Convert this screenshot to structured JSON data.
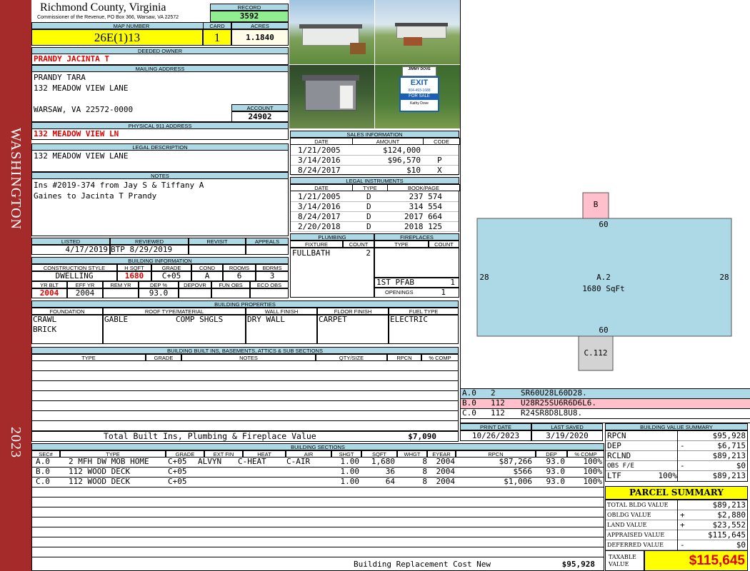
{
  "sidebar": {
    "district": "WASHINGTON",
    "year": "2023"
  },
  "header": {
    "county": "Richmond County, Virginia",
    "commissioner": "Commissioner of the Revenue, PO Box 366, Warsaw, VA 22572",
    "record_label": "RECORD",
    "record": "3592",
    "map_label": "MAP NUMBER",
    "map_number": "26E(1)13",
    "card_label": "CARD",
    "card": "1",
    "acres_label": "ACRES",
    "acres": "1.1840"
  },
  "owner": {
    "label": "DEEDED OWNER",
    "name": "PRANDY JACINTA T"
  },
  "mailing": {
    "label": "MAILING ADDRESS",
    "line1": "PRANDY TARA",
    "line2": "132 MEADOW VIEW LANE",
    "line3": "WARSAW, VA 22572-0000",
    "account_label": "ACCOUNT",
    "account": "24902"
  },
  "physical": {
    "label": "PHYSICAL 911 ADDRESS",
    "address": "132 MEADOW VIEW LN"
  },
  "legal": {
    "label": "LEGAL DESCRIPTION",
    "text": "132 MEADOW VIEW LANE"
  },
  "notes": {
    "label": "NOTES",
    "line1": "Ins #2019-374 from Jay S & Tiffany A",
    "line2": "Gaines to Jacinta T Prandy"
  },
  "photos": {
    "sign_name": "JIMMY DOVE",
    "sign_brand": "EXIT",
    "sign_phone": "804-493-1688",
    "sign_forsale": "FOR SALE",
    "sign_agent": "Kathy Dove"
  },
  "sales": {
    "label": "SALES INFORMATION",
    "headers": [
      "DATE",
      "AMOUNT",
      "CODE"
    ],
    "rows": [
      {
        "date": "1/21/2005",
        "amount": "$124,000",
        "code": ""
      },
      {
        "date": "3/14/2016",
        "amount": "$96,570",
        "code": "P"
      },
      {
        "date": "8/24/2017",
        "amount": "$10",
        "code": "X"
      }
    ]
  },
  "instruments": {
    "label": "LEGAL INSTRUMENTS",
    "headers": [
      "DATE",
      "TYPE",
      "BOOK/PAGE"
    ],
    "rows": [
      {
        "date": "1/21/2005",
        "type": "D",
        "book": "237 574"
      },
      {
        "date": "3/14/2016",
        "type": "D",
        "book": "314 554"
      },
      {
        "date": "8/24/2017",
        "type": "D",
        "book": "2017 664"
      },
      {
        "date": "2/20/2018",
        "type": "D",
        "book": "2018 125"
      }
    ]
  },
  "listing": {
    "listed_label": "LISTED",
    "listed": "4/17/2019",
    "reviewed_label": "REVIEWED",
    "reviewed": "BTP  8/29/2019",
    "revisit_label": "REVISIT",
    "appeals_label": "APPEALS"
  },
  "building_info": {
    "label": "BUILDING INFORMATION",
    "headers": [
      "CONSTRUCTION STYLE",
      "H SQFT",
      "GRADE",
      "COND",
      "ROOMS",
      "BDRMS"
    ],
    "style": "DWELLING",
    "sqft": "1680",
    "grade": "C+05",
    "cond": "A",
    "rooms": "6",
    "bdrms": "3",
    "headers2": [
      "YR BLT",
      "EFF YR",
      "REM YR",
      "DEP %",
      "DEPOVR",
      "FUN OBS",
      "ECO OBS"
    ],
    "yr_blt": "2004",
    "eff_yr": "2004",
    "rem_yr": "",
    "dep": "93.0"
  },
  "plumbing": {
    "label": "PLUMBING",
    "headers": [
      "FIXTURE",
      "COUNT"
    ],
    "fixture": "FULLBATH",
    "count": "2",
    "pfab_label": "1ST PFAB",
    "pfab": "1",
    "openings_label": "OPENINGS",
    "openings": "1"
  },
  "fireplaces": {
    "label": "FIREPLACES",
    "headers": [
      "TYPE",
      "COUNT"
    ]
  },
  "properties": {
    "label": "BUILDING PROPERTIES",
    "headers": [
      "FOUNDATION",
      "ROOF TYPE/MATERIAL",
      "WALL FINISH",
      "FLOOR FINISH",
      "FUEL TYPE"
    ],
    "foundation1": "CRAWL",
    "foundation2": "BRICK",
    "roof_type": "GABLE",
    "roof_mat": "COMP SHGLS",
    "wall": "DRY WALL",
    "floor": "CARPET",
    "fuel": "ELECTRIC"
  },
  "builtins": {
    "label": "BUILDING BUILT INS, BASEMENTS, ATTICS & SUB SECTIONS",
    "headers": [
      "TYPE",
      "GRADE",
      "NOTES",
      "QTY/SIZE",
      "RPCN",
      "% COMP"
    ],
    "total_label": "Total Built Ins, Plumbing & Fireplace Value",
    "total": "$7,090"
  },
  "sketch": {
    "b_label": "B",
    "c_label": "C.112",
    "a_label": "A.2",
    "a_area": "1680 SqFt",
    "top": "60",
    "bottom": "60",
    "left": "28",
    "right": "28",
    "legend": [
      {
        "id": "A.0",
        "n": "2",
        "desc": "SR60U28L60D28."
      },
      {
        "id": "B.0",
        "n": "112",
        "desc": "U28R25SU6R6D6L6."
      },
      {
        "id": "C.0",
        "n": "112",
        "desc": "R24SR8D8L8U8."
      }
    ],
    "colors": {
      "main": "#add8e6",
      "b": "#ffc0cb",
      "c": "#d3d3d3"
    }
  },
  "dates": {
    "print_label": "PRINT DATE",
    "print": "10/26/2023",
    "saved_label": "LAST SAVED",
    "saved": "3/19/2020"
  },
  "sections": {
    "label": "BUILDING SECTIONS",
    "headers": [
      "SEC#",
      "TYPE",
      "GRADE",
      "EXT FIN",
      "HEAT",
      "AIR",
      "SHGT",
      "SQFT",
      "WHGT",
      "EYEAR",
      "RPCN",
      "DEP",
      "% COMP"
    ],
    "rows": [
      {
        "sec": "A.0",
        "type": "2 MFH DW MOB HOME",
        "grade": "C+05",
        "ext": "ALVYN",
        "heat": "C-HEAT",
        "air": "C-AIR",
        "shgt": "1.00",
        "sqft": "1,680",
        "whgt": "8",
        "eyear": "2004",
        "rpcn": "$87,266",
        "dep": "93.0",
        "comp": "100%"
      },
      {
        "sec": "B.0",
        "type": "112 WOOD DECK",
        "grade": "C+05",
        "ext": "",
        "heat": "",
        "air": "",
        "shgt": "1.00",
        "sqft": "36",
        "whgt": "8",
        "eyear": "2004",
        "rpcn": "$566",
        "dep": "93.0",
        "comp": "100%"
      },
      {
        "sec": "C.0",
        "type": "112 WOOD DECK",
        "grade": "C+05",
        "ext": "",
        "heat": "",
        "air": "",
        "shgt": "1.00",
        "sqft": "64",
        "whgt": "8",
        "eyear": "2004",
        "rpcn": "$1,006",
        "dep": "93.0",
        "comp": "100%"
      }
    ],
    "replacement_label": "Building Replacement Cost New",
    "replacement": "$95,928"
  },
  "value_summary": {
    "label": "BUILDING VALUE SUMMARY",
    "rpcn": "$95,928",
    "dep_sign": "-",
    "dep": "$6,715",
    "rclnd": "$89,213",
    "obs_label": "OBS F/E",
    "obs_sign": "-",
    "obs": "$0",
    "ltr_label": "LTF",
    "ltr_pct": "100%",
    "ltr": "$89,213"
  },
  "parcel": {
    "label": "PARCEL SUMMARY",
    "rows": [
      {
        "label": "TOTAL BLDG VALUE",
        "sign": "",
        "value": "$89,213"
      },
      {
        "label": "OBLDG VALUE",
        "sign": "+",
        "value": "$2,880"
      },
      {
        "label": "LAND VALUE",
        "sign": "+",
        "value": "$23,552"
      },
      {
        "label": "APPRAISED VALUE",
        "sign": "",
        "value": "$115,645"
      },
      {
        "label": "DEFERRED VALUE",
        "sign": "-",
        "value": "$0"
      }
    ],
    "taxable_label1": "TAXABLE",
    "taxable_label2": "VALUE",
    "taxable": "$115,645"
  }
}
